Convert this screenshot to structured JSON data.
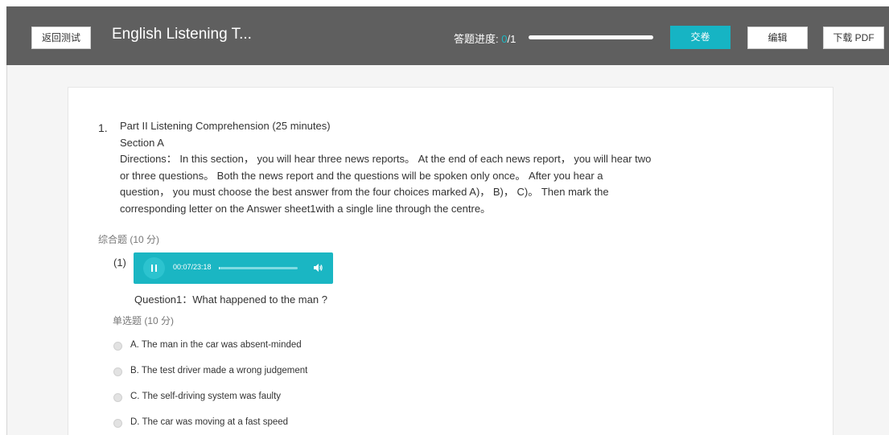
{
  "header": {
    "back_label": "返回测试",
    "title": "English Listening T...",
    "progress_label": "答题进度: ",
    "progress_done": "0",
    "progress_total": "/1",
    "progress_fraction": 0,
    "submit_label": "交卷",
    "edit_label": "编辑",
    "pdf_label": "下载 PDF",
    "accent_color": "#16b4c4"
  },
  "question": {
    "number": "1.",
    "lines": [
      "Part II Listening Comprehension (25 minutes)",
      "Section A",
      "Directions： In this section， you will hear three news reports。 At the end of each news report， you will hear two",
      "or three questions。 Both the news report and the questions will be spoken only once。 After you hear a",
      "question， you must choose the best answer from the four choices marked A)， B)， C)。 Then mark the",
      "corresponding letter on the Answer sheet1with a single line through the centre。"
    ],
    "type_label": "综合题 (10 分)"
  },
  "sub": {
    "number": "(1)",
    "audio": {
      "time": "00:07/23:18",
      "progress_fraction": 0.005,
      "pause_icon": "pause-icon",
      "volume_icon": "volume-icon"
    },
    "question_text": "Question1：What happened to the man ?",
    "type_label": "单选题 (10 分)",
    "options": [
      "A. The man in the car was absent-minded",
      "B. The test driver made a wrong judgement",
      "C. The self-driving system was faulty",
      "D. The car was moving at a fast speed"
    ]
  }
}
